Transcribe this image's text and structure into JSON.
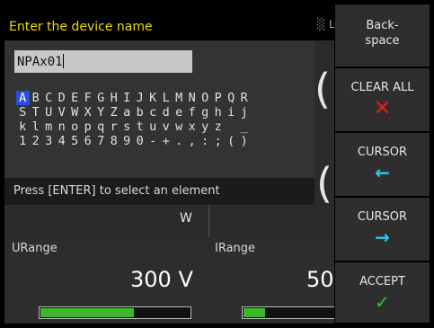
{
  "dialog": {
    "title": "Enter the device name",
    "input_value": "NPAx01",
    "hint": "Press [ENTER] to select an element",
    "charmap": [
      [
        "A",
        "B",
        "C",
        "D",
        "E",
        "F",
        "G",
        "H",
        "I",
        "J",
        "K",
        "L",
        "M",
        "N",
        "O",
        "P",
        "Q",
        "R"
      ],
      [
        "S",
        "T",
        "U",
        "V",
        "W",
        "X",
        "Y",
        "Z",
        "a",
        "b",
        "c",
        "d",
        "e",
        "f",
        "g",
        "h",
        "i",
        "j"
      ],
      [
        "k",
        "l",
        "m",
        "n",
        "o",
        "p",
        "q",
        "r",
        "s",
        "t",
        "u",
        "v",
        "w",
        "x",
        "y",
        "z",
        " ",
        "_"
      ],
      [
        "1",
        "2",
        "3",
        "4",
        "5",
        "6",
        "7",
        "8",
        "9",
        "0",
        "-",
        "+",
        ".",
        ",",
        ":",
        ";",
        "(",
        ")"
      ]
    ],
    "selected_char": "A"
  },
  "softkeys": [
    {
      "label": "Back-\nspace",
      "icon": null
    },
    {
      "label": "CLEAR ALL",
      "icon": "x-icon"
    },
    {
      "label": "CURSOR",
      "icon": "arrow-left-icon"
    },
    {
      "label": "CURSOR",
      "icon": "arrow-right-icon"
    },
    {
      "label": "ACCEPT",
      "icon": "check-icon"
    }
  ],
  "background": {
    "unit_w": "W",
    "fragments": {
      "top_small": "░ L",
      "mid_big_1": "(",
      "mid_big_2": "("
    },
    "urange": {
      "label": "URange",
      "value": "300 V",
      "fill": 0.62
    },
    "irange": {
      "label": "IRange",
      "value": "50",
      "fill": 0.2
    }
  },
  "colors": {
    "title": "#f0d800",
    "accent_blue": "#2850e0",
    "bar_green": "#3cb828",
    "clear_red": "#e02020",
    "cursor_cyan": "#2dc8f0",
    "accept_green": "#2fc23a"
  }
}
